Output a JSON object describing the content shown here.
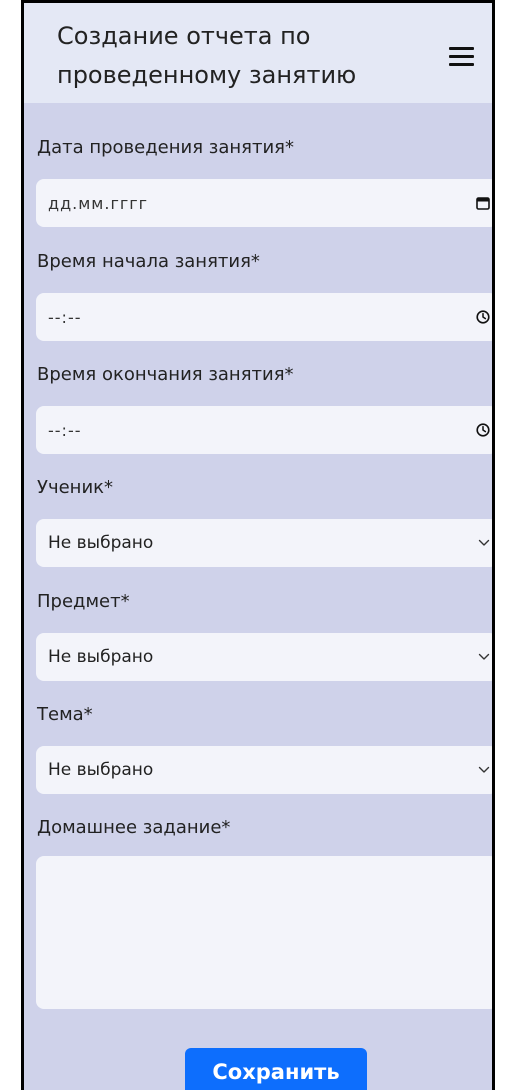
{
  "header": {
    "title": "Создание отчета по проведенному занятию"
  },
  "form": {
    "date": {
      "label": "Дата проведения занятия*",
      "placeholder": "дд.мм.гггг"
    },
    "time_start": {
      "label": "Время начала занятия*",
      "placeholder": "--:--"
    },
    "time_end": {
      "label": "Время окончания занятия*",
      "placeholder": "--:--"
    },
    "student": {
      "label": "Ученик*",
      "value": "Не выбрано"
    },
    "subject": {
      "label": "Предмет*",
      "value": "Не выбрано"
    },
    "topic": {
      "label": "Тема*",
      "value": "Не выбрано"
    },
    "homework": {
      "label": "Домашнее задание*",
      "value": ""
    },
    "save_label": "Сохранить"
  },
  "icons": {
    "menu": "hamburger-menu-icon",
    "date": "calendar-icon",
    "time": "clock-icon",
    "select": "chevron-down-icon"
  },
  "colors": {
    "page_bg": "#cfd2ea",
    "header_bg": "#e4e8f5",
    "field_bg": "#f3f4fa",
    "accent": "#0d6efd"
  }
}
